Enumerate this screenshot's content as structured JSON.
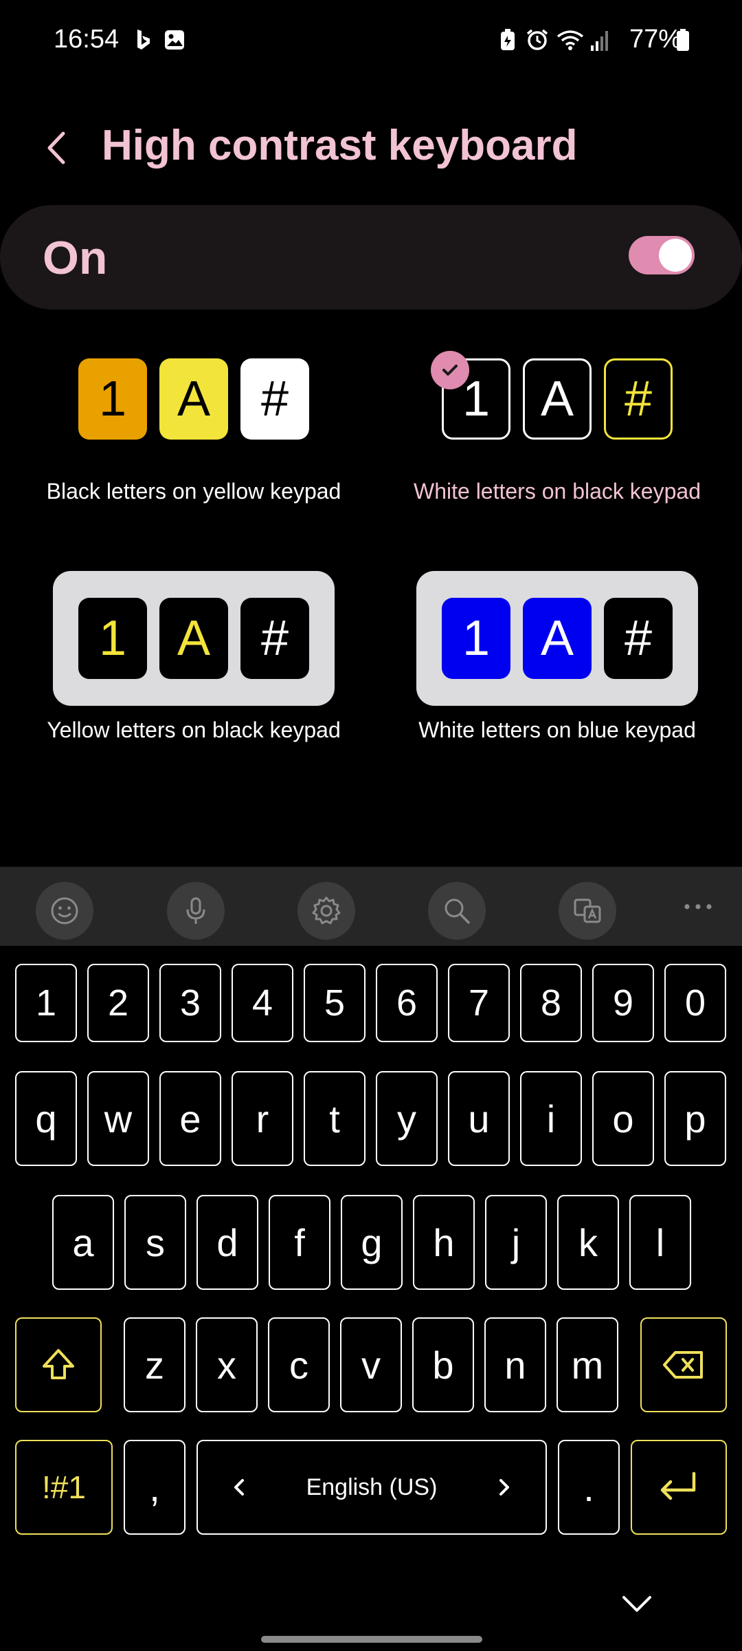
{
  "status_bar": {
    "time": "16:54",
    "battery": "77%",
    "icons": [
      "bing-icon",
      "gallery-icon",
      "battery-saver-icon",
      "alarm-icon",
      "wifi-icon",
      "signal-icon",
      "battery-icon"
    ]
  },
  "header": {
    "title": "High contrast keyboard",
    "back_icon": "chevron-left-icon"
  },
  "master_switch": {
    "label": "On",
    "enabled": true,
    "accent": "#e08bb0"
  },
  "themes": [
    {
      "label": "Black letters on yellow keypad",
      "keys": [
        "1",
        "A",
        "#"
      ],
      "selected": false
    },
    {
      "label": "White letters on black keypad",
      "keys": [
        "1",
        "A",
        "#"
      ],
      "selected": true
    },
    {
      "label": "Yellow letters on black keypad",
      "keys": [
        "1",
        "A",
        "#"
      ],
      "selected": false
    },
    {
      "label": "White letters on blue keypad",
      "keys": [
        "1",
        "A",
        "#"
      ],
      "selected": false
    }
  ],
  "toolbar": [
    "emoji-icon",
    "microphone-icon",
    "settings-icon",
    "search-icon",
    "translate-icon",
    "more-icon"
  ],
  "keyboard": {
    "row_numbers": [
      "1",
      "2",
      "3",
      "4",
      "5",
      "6",
      "7",
      "8",
      "9",
      "0"
    ],
    "row1": [
      "q",
      "w",
      "e",
      "r",
      "t",
      "y",
      "u",
      "i",
      "o",
      "p"
    ],
    "row2": [
      "a",
      "s",
      "d",
      "f",
      "g",
      "h",
      "j",
      "k",
      "l"
    ],
    "row3": [
      "z",
      "x",
      "c",
      "v",
      "b",
      "n",
      "m"
    ],
    "symbols_label": "!#1",
    "comma": ",",
    "space_label": "English (US)",
    "period": ".",
    "accent_color": "#efe05a"
  }
}
